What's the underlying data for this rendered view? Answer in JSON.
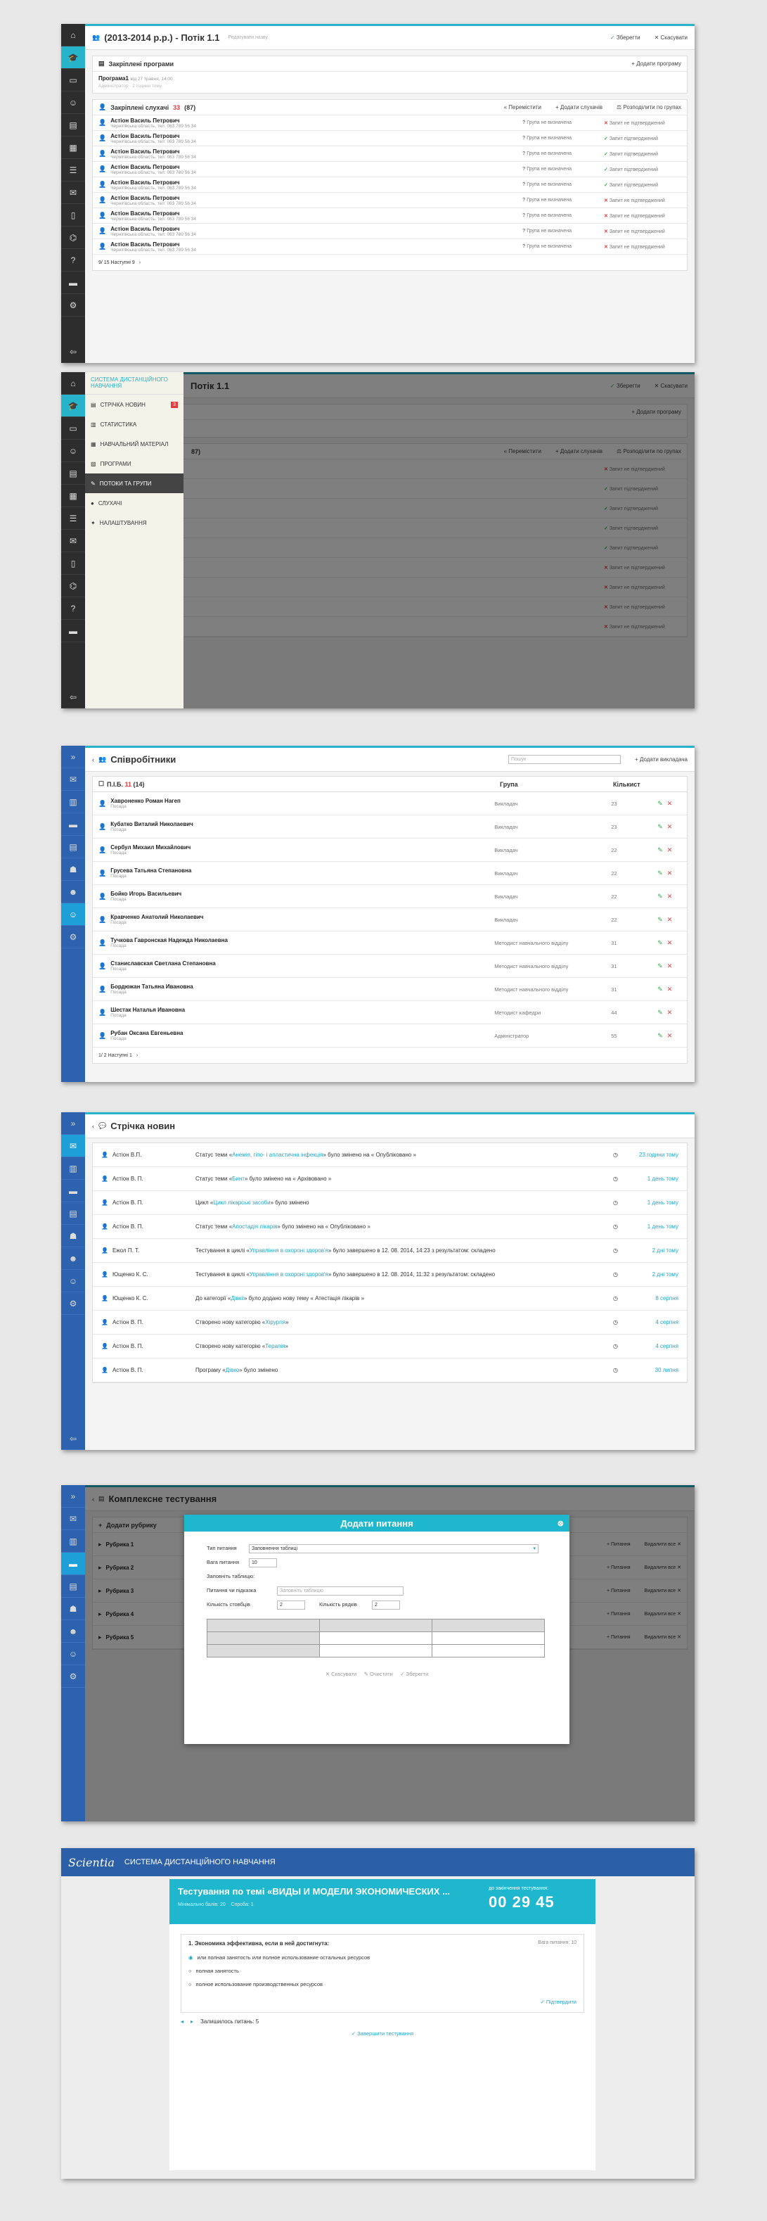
{
  "s1": {
    "title": "(2013-2014 р.р.) - Потік 1.1",
    "subtitle": "Редагувати назву",
    "save": "Зберегти",
    "cancel": "Скасувати",
    "programs_title": "Закріплені програми",
    "add_program": "Додати програму",
    "program_name": "Програма1",
    "program_meta": "від 27 травня, 14:00",
    "program_author": "Адміністратор · 2 години тому",
    "listeners_title": "Закріплені слухачі",
    "listeners_count": "33",
    "listeners_total": "(87)",
    "move": "Перемістити",
    "add_listeners": "Додати слухачів",
    "distribute": "Розподілити по групах",
    "group_none": "Група не визначена",
    "req_confirmed": "Запит підтверджений",
    "req_unconfirmed": "Запит не підтверджений",
    "rows": [
      {
        "name": "Астіон Василь Петрович",
        "info": "Чернігівська область, тел: 063 789 56 34",
        "status": "no"
      },
      {
        "name": "Астіон Василь Петрович",
        "info": "Чернігівська область, тел: 063 789 56 34",
        "status": "yes"
      },
      {
        "name": "Астіон Василь Петрович",
        "info": "Чернігівська область, тел: 063 789 56 34",
        "status": "yes"
      },
      {
        "name": "Астіон Василь Петрович",
        "info": "Чернігівська область, тел: 063 789 56 34",
        "status": "yes"
      },
      {
        "name": "Астіон Василь Петрович",
        "info": "Чернігівська область, тел: 063 789 56 34",
        "status": "yes"
      },
      {
        "name": "Астіон Василь Петрович",
        "info": "Чернігівська область, тел: 063 789 56 34",
        "status": "no"
      },
      {
        "name": "Астіон Василь Петрович",
        "info": "Чернігівська область, тел: 063 789 56 34",
        "status": "no"
      },
      {
        "name": "Астіон Василь Петрович",
        "info": "Чернігівська область, тел: 063 789 56 34",
        "status": "no"
      },
      {
        "name": "Астіон Василь Петрович",
        "info": "Чернігівська область, тел: 063 789 56 34",
        "status": "no"
      }
    ],
    "pager": "9/ 15  Наступні 9"
  },
  "s2": {
    "app_title": "СИСТЕМА ДИСТАНЦІЙНОГО НАВЧАННЯ",
    "menu": [
      {
        "label": "СТРІЧКА НОВИН",
        "badge": "3"
      },
      {
        "label": "СТАТИСТИКА"
      },
      {
        "label": "НАВЧАЛЬНИЙ МАТЕРІАЛ"
      },
      {
        "label": "ПРОГРАМИ"
      },
      {
        "label": "ПОТОКИ ТА ГРУПИ"
      },
      {
        "label": "СЛУХАЧІ"
      },
      {
        "label": "НАЛАШТУВАННЯ"
      }
    ],
    "bg_title": "Потік 1.1",
    "bg_count": "87)"
  },
  "s3": {
    "title": "Співробітники",
    "search": "Пошук",
    "add": "Додати викладача",
    "col_name": "П.І.Б.",
    "col_count": "11",
    "col_total": "(14)",
    "col_group": "Група",
    "col_lessons": "Кількист",
    "position": "Посада",
    "rows": [
      {
        "name": "Хавроненко Роман Нагеп",
        "group": "Викладач",
        "n": "23"
      },
      {
        "name": "Кубатко Виталий Николаевич",
        "group": "Викладач",
        "n": "23"
      },
      {
        "name": "Сербул Михаил Михайлович",
        "group": "Викладач",
        "n": "22"
      },
      {
        "name": "Грусева Татьяна Степановна",
        "group": "Викладач",
        "n": "22"
      },
      {
        "name": "Бойко Игорь Васильевич",
        "group": "Викладач",
        "n": "22"
      },
      {
        "name": "Кравченко Анатолий Николаевич",
        "group": "Викладач",
        "n": "22"
      },
      {
        "name": "Тучкова Гавронская Надежда Николаевна",
        "group": "Методист навчального відділу",
        "n": "31"
      },
      {
        "name": "Станиславская Светлана Степановна",
        "group": "Методист навчального відділу",
        "n": "31"
      },
      {
        "name": "Бордюжан Татьяна Ивановна",
        "group": "Методист навчального відділу",
        "n": "31"
      },
      {
        "name": "Шестак Наталья Ивановна",
        "group": "Методист кафедри",
        "n": "44"
      },
      {
        "name": "Рубан Оксана Евгеньевна",
        "group": "Адміністратор",
        "n": "55"
      }
    ],
    "pager": "1/ 2   Наступні 1"
  },
  "s4": {
    "title": "Стрічка новин",
    "rows": [
      {
        "who": "Астіон В.П.",
        "pre": "Статус теми «",
        "link": "Анемія, гіпо- і апластична інфекція",
        "post": "» було змінено на « Опубліковано »",
        "time": "23 години тому"
      },
      {
        "who": "Астіон В. П.",
        "pre": "Статус теми «",
        "link": "Бинт",
        "post": "» було змінено на « Архівовано »",
        "time": "1 день тому"
      },
      {
        "who": "Астіон В. П.",
        "pre": "Цикл «",
        "link": "Цикл лікарські засоби",
        "post": "» було змінено",
        "time": "1 день тому"
      },
      {
        "who": "Астіон В. П.",
        "pre": "Статус теми «",
        "link": "Апостадія лікарів",
        "post": "» було змінено на « Опубліковано »",
        "time": "1 день тому"
      },
      {
        "who": "Ежол П. Т.",
        "pre": "Тестування в циклі «",
        "link": "Управління в охороні здоров'я",
        "post": "» було завершено в 12. 08. 2014, 14:23 з результатом: складено",
        "time": "2 дні тому"
      },
      {
        "who": "Ющенко К. С.",
        "pre": "Тестування в циклі «",
        "link": "Управління в охороні здоров'я",
        "post": "» було завершено в 12. 08. 2014, 11:32 з результатом: складено",
        "time": "2 дні тому"
      },
      {
        "who": "Ющенко К. С.",
        "pre": "До категорії «",
        "link": "Дівкіі",
        "post": "» було додано нову тему « Атестація лікарів »",
        "time": "8 серпня"
      },
      {
        "who": "Астіон В. П.",
        "pre": "Створено нову категорію «",
        "link": "Хірургія",
        "post": "»",
        "time": "4 серпня"
      },
      {
        "who": "Астіон В. П.",
        "pre": "Створено нову категорію «",
        "link": "Терапія",
        "post": "»",
        "time": "4 серпня"
      },
      {
        "who": "Астіон В. П.",
        "pre": "Програму «",
        "link": "Дівко",
        "post": "» було змінено",
        "time": "30 липня"
      }
    ]
  },
  "s5": {
    "title": "Комплексне тестування",
    "add_rubric": "Додати рубрику",
    "rubrics": [
      "Рубрика 1",
      "Рубрика 2",
      "Рубрика 3",
      "Рубрика 4",
      "Рубрика 5"
    ],
    "add_q": "Питання",
    "delete": "Видалити все",
    "modal_title": "Додати питання",
    "type_label": "Тип питання",
    "type_value": "Заповнення таблиці",
    "weight_label": "Вага питання",
    "weight_value": "10",
    "fill_label": "Заповніть таблицю:",
    "q_label": "Питання чи підказка",
    "q_placeholder": "Заповніть таблицю",
    "cols_label": "Кількість стовбців",
    "cols_value": "2",
    "rows_label": "Кількість рядків",
    "rows_value": "2",
    "btn_cancel": "Скасувати",
    "btn_clear": "Очистити",
    "btn_save": "Зберегти"
  },
  "s6": {
    "logo": "Scientia",
    "app_title": "СИСТЕМА ДИСТАНЦІЙНОГО НАВЧАННЯ",
    "test_title": "Тестування по темі «ВИДЫ И МОДЕЛИ ЭКОНОМИЧЕСКИХ ...",
    "meta1": "Мінімально балів: 20",
    "meta2": "Спроба: 1",
    "timer_label": "до закінчення тестування:",
    "timer": "00 29 45",
    "question": "1. Экономика эффективна, если в ней достигнута:",
    "weight": "Вага питання: 10",
    "options": [
      "или полная занятость или полное использование остальных ресурсов",
      "полная занятость",
      "полное использование производственных ресурсов"
    ],
    "confirm": "Підтвердити",
    "remaining": "Залишилось питань: 5",
    "finish": "Завершити тестування"
  }
}
